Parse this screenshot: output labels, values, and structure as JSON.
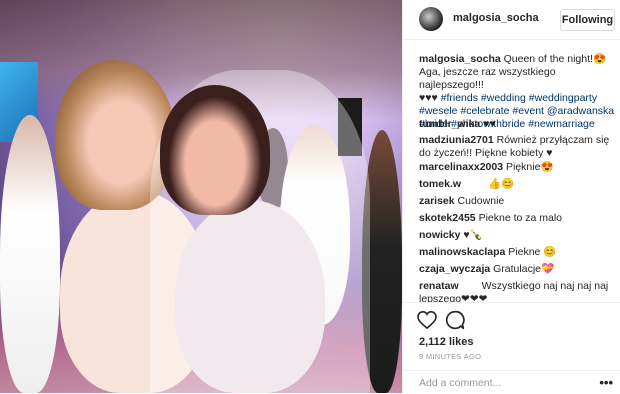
{
  "post": {
    "author": "malgosia_socha",
    "follow_label": "Following",
    "caption_user": "malgosia_socha",
    "caption_text_1": "Queen of the night!😍",
    "caption_text_2": "Aga, jeszcze raz wszystkiego najlepszego!!!",
    "caption_hearts": "♥♥♥",
    "hashtags": [
      "#friends",
      "#wedding",
      "#weddingparty",
      "#wesele",
      "#celebrate",
      "#event",
      "@aradwanska",
      "#bride",
      "#photowithbride",
      "#newmarriage"
    ],
    "likes": "2,112 likes",
    "time_ago": "9 MINUTES AGO",
    "add_comment_placeholder": "Add a comment...",
    "more_label": "•••"
  },
  "comments": [
    {
      "user": "tumblr_wika",
      "text": "♥♥"
    },
    {
      "user": "madziunia2701",
      "text": "Również przyłączam się do życzeń!! Piękne kobiety ♥"
    },
    {
      "user": "marcelinaxx2003",
      "text": "Pięknie😍"
    },
    {
      "user": "tomek.w",
      "text": "👍😊"
    },
    {
      "user": "zarisek",
      "text": "Cudownie"
    },
    {
      "user": "skotek2455",
      "text": "Piekne to za malo"
    },
    {
      "user": "nowicky",
      "text": "♥🍾"
    },
    {
      "user": "malinowskaclapa",
      "text": "Piekne 😊"
    },
    {
      "user": "czaja_wyczaja",
      "text": "Gratulacje💝"
    },
    {
      "user": "renataw",
      "text": "Wszystkiego naj naj naj naj lepszego❤❤❤"
    }
  ],
  "icons": {
    "heart": "heart-icon",
    "comment": "comment-icon"
  },
  "colors": {
    "hashtag": "#003569",
    "text": "#262626",
    "muted": "#999999"
  }
}
